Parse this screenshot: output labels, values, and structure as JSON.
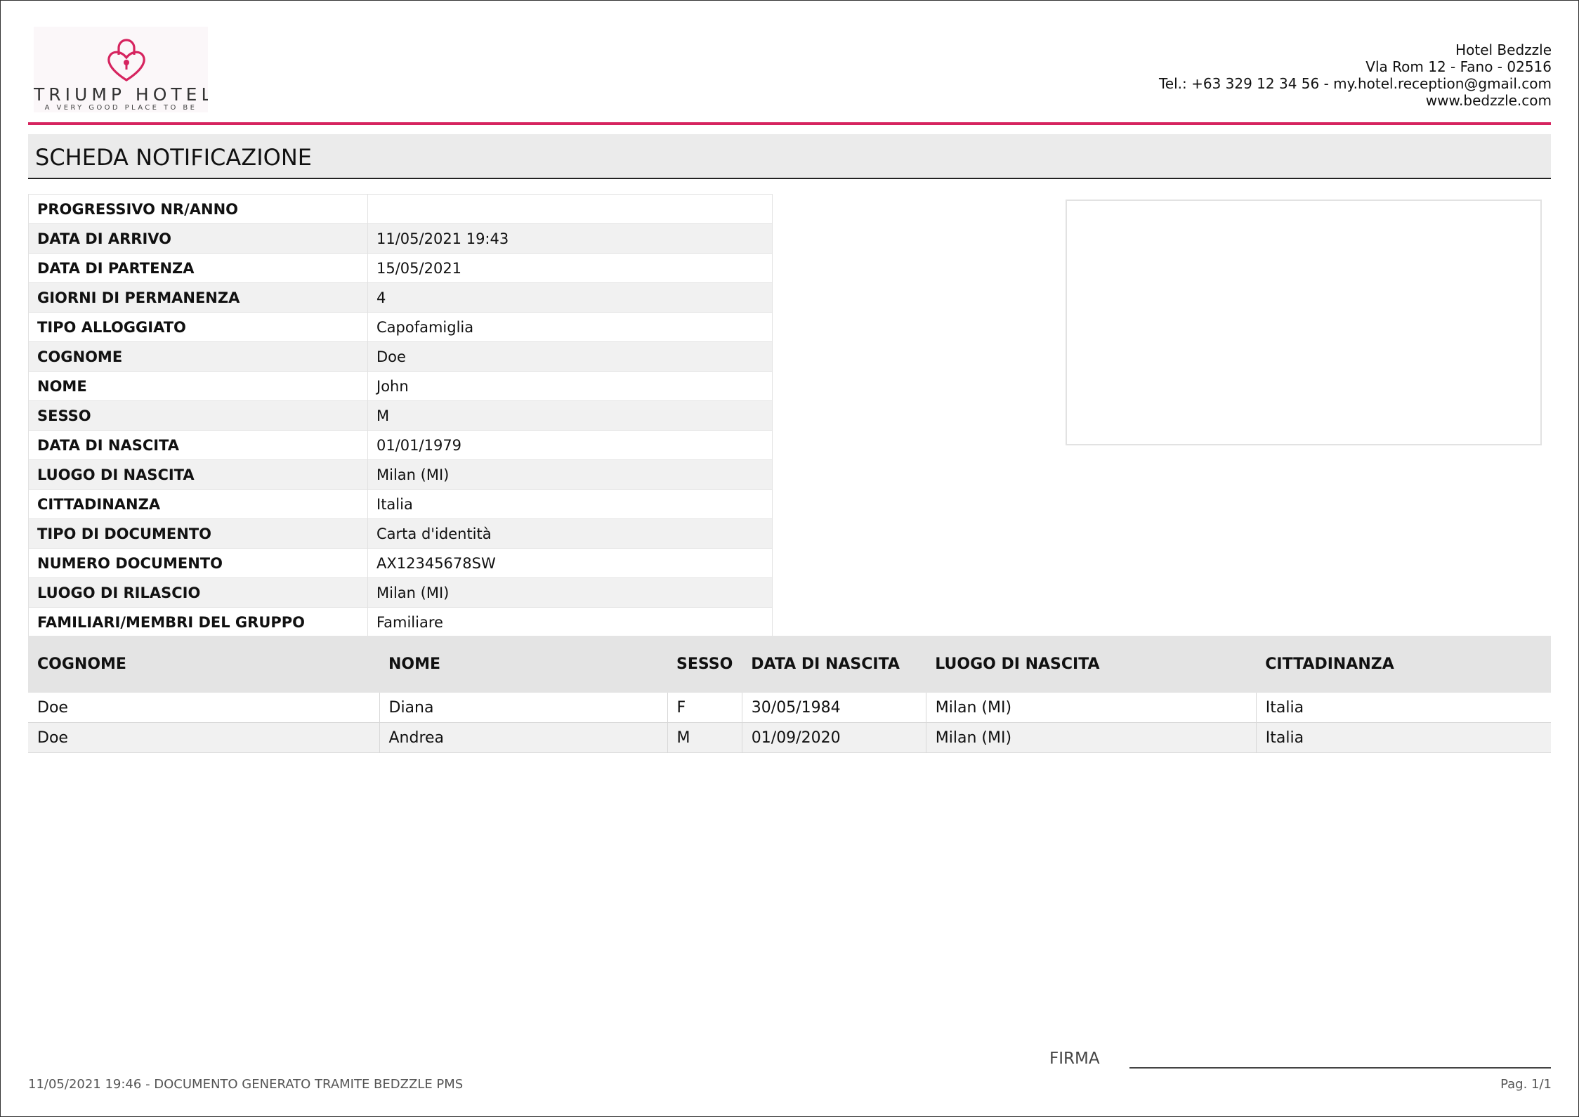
{
  "brand": {
    "logo_text": "TRIUMP HOTEL",
    "tagline": "A VERY GOOD PLACE TO BE",
    "accent_color": "#d6245f"
  },
  "hotel": {
    "name": "Hotel Bedzzle",
    "address": "Vla Rom 12 - Fano - 02516",
    "contact": "Tel.: +63 329 12 34 56 - my.hotel.reception@gmail.com",
    "website": "www.bedzzle.com"
  },
  "title": "SCHEDA NOTIFICAZIONE",
  "fields": [
    {
      "label": "PROGRESSIVO NR/ANNO",
      "value": ""
    },
    {
      "label": "DATA DI ARRIVO",
      "value": "11/05/2021 19:43"
    },
    {
      "label": "DATA DI PARTENZA",
      "value": "15/05/2021"
    },
    {
      "label": "GIORNI DI PERMANENZA",
      "value": "4"
    },
    {
      "label": "TIPO ALLOGGIATO",
      "value": "Capofamiglia"
    },
    {
      "label": "COGNOME",
      "value": "Doe"
    },
    {
      "label": "NOME",
      "value": "John"
    },
    {
      "label": "SESSO",
      "value": "M"
    },
    {
      "label": "DATA DI NASCITA",
      "value": "01/01/1979"
    },
    {
      "label": "LUOGO DI NASCITA",
      "value": "Milan (MI)"
    },
    {
      "label": "CITTADINANZA",
      "value": "Italia"
    },
    {
      "label": "TIPO DI DOCUMENTO",
      "value": "Carta d'identità"
    },
    {
      "label": "NUMERO DOCUMENTO",
      "value": "AX12345678SW"
    },
    {
      "label": "LUOGO DI RILASCIO",
      "value": "Milan (MI)"
    },
    {
      "label": "FAMILIARI/MEMBRI DEL GRUPPO",
      "value": "Familiare"
    }
  ],
  "members": {
    "columns": [
      "COGNOME",
      "NOME",
      "SESSO",
      "DATA DI NASCITA",
      "LUOGO DI NASCITA",
      "CITTADINANZA"
    ],
    "rows": [
      [
        "Doe",
        "Diana",
        "F",
        "30/05/1984",
        "Milan (MI)",
        "Italia"
      ],
      [
        "Doe",
        "Andrea",
        "M",
        "01/09/2020",
        "Milan (MI)",
        "Italia"
      ]
    ]
  },
  "signature": {
    "label": "FIRMA"
  },
  "footer": {
    "generated": "11/05/2021 19:46 - DOCUMENTO GENERATO TRAMITE BEDZZLE PMS",
    "page": "Pag. 1/1"
  }
}
